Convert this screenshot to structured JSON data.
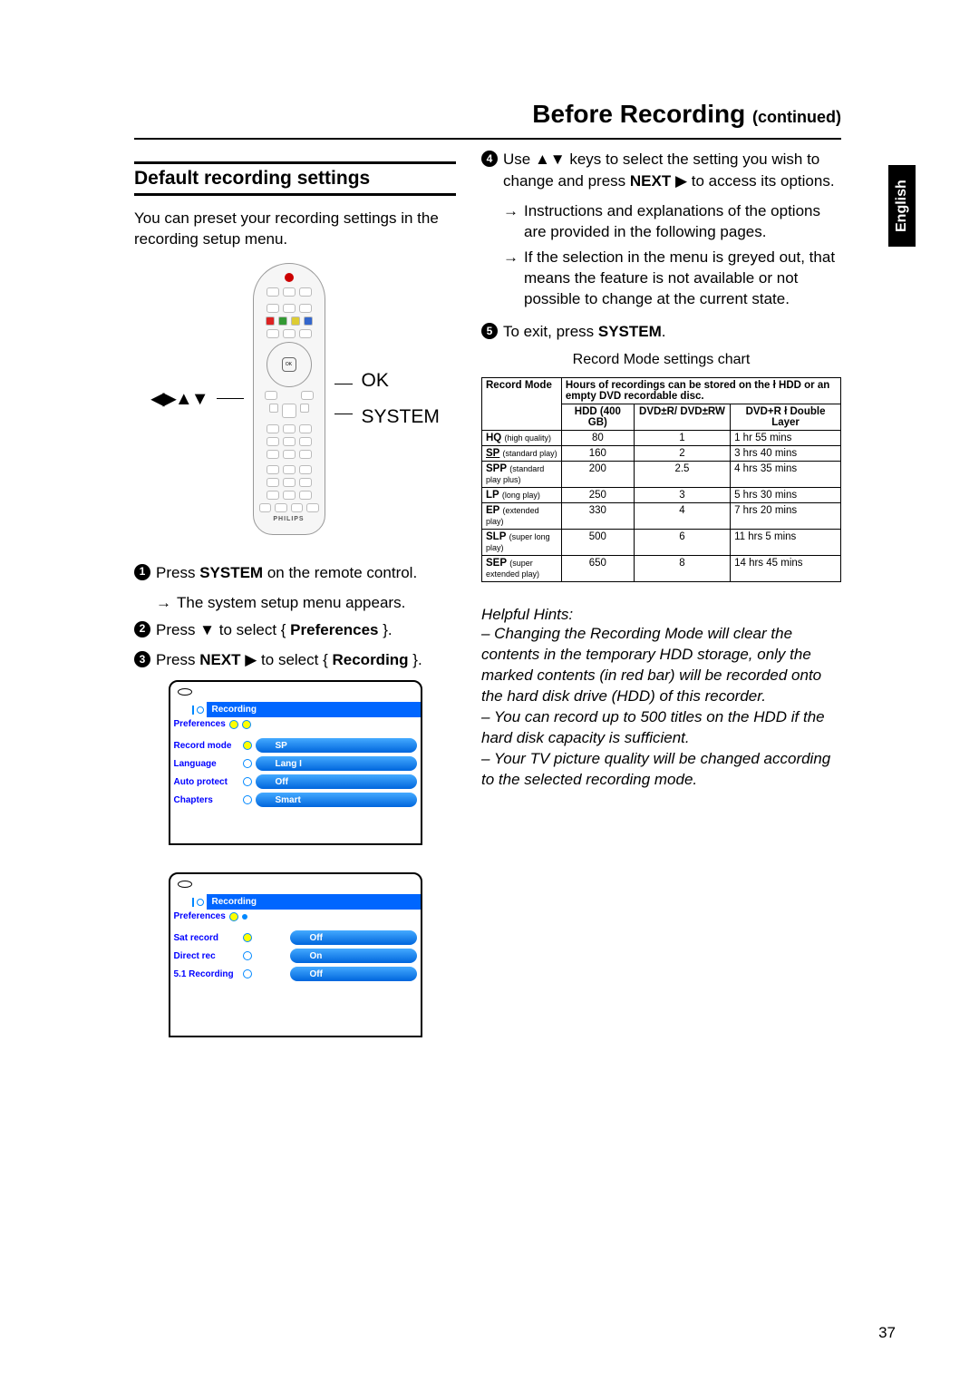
{
  "pageTitle": "Before Recording",
  "pageTitleCont": "(continued)",
  "langTab": "English",
  "pageNumber": "37",
  "section": {
    "heading": "Default recording settings",
    "intro": "You can preset your recording settings in the recording setup menu."
  },
  "remote": {
    "arrows": "◀▶▲▼",
    "okLabel": "OK",
    "systemLabel": "SYSTEM",
    "brand": "PHILIPS"
  },
  "steps": {
    "s1a": "Press ",
    "s1b": "SYSTEM",
    "s1c": " on the remote control.",
    "s1sub": "The system setup menu appears.",
    "s2a": "Press ▼ to select { ",
    "s2b": "Preferences",
    "s2c": " }.",
    "s3a": "Press ",
    "s3b": "NEXT",
    "s3c": " ▶ to select { ",
    "s3d": "Recording",
    "s3e": " }.",
    "s4a": "Use ▲▼ keys to select the setting you wish to change and press ",
    "s4b": "NEXT",
    "s4c": " ▶ to access its options.",
    "s4sub1": "Instructions and explanations of the options are provided in the following pages.",
    "s4sub2": "If the selection in the menu is greyed out, that means the feature is not available or not possible to change at the current state.",
    "s5a": "To exit, press ",
    "s5b": "SYSTEM",
    "s5c": "."
  },
  "screens": {
    "tab": "Recording",
    "pref": "Preferences",
    "menu1": [
      {
        "label": "Record mode",
        "value": "SP"
      },
      {
        "label": "Language",
        "value": "Lang I"
      },
      {
        "label": "Auto protect",
        "value": "Off"
      },
      {
        "label": "Chapters",
        "value": "Smart"
      }
    ],
    "menu2": [
      {
        "label": "Sat record",
        "value": "Off"
      },
      {
        "label": "Direct rec",
        "value": "On"
      },
      {
        "label": "5.1 Recording",
        "value": "Off"
      }
    ]
  },
  "chartCaption": "Record Mode settings chart",
  "chart_data": {
    "type": "table",
    "header_main": "Record Mode",
    "header_desc": "Hours of recordings can be stored on the ł HDD or an empty DVD recordable disc.",
    "columns": [
      "HDD (400 GB)",
      "DVD±R/ DVD±RW",
      "DVD+R ł Double Layer"
    ],
    "rows": [
      {
        "mode": "HQ",
        "sub": "(high quality)",
        "hdd": "80",
        "dvd": "1",
        "dl": "1 hr 55 mins"
      },
      {
        "mode": "SP",
        "sub": "(standard play)",
        "underline": true,
        "hdd": "160",
        "dvd": "2",
        "dl": "3 hrs 40 mins"
      },
      {
        "mode": "SPP",
        "sub": "(standard play plus)",
        "hdd": "200",
        "dvd": "2.5",
        "dl": "4 hrs 35 mins"
      },
      {
        "mode": "LP",
        "sub": "(long play)",
        "hdd": "250",
        "dvd": "3",
        "dl": "5 hrs 30 mins"
      },
      {
        "mode": "EP",
        "sub": "(extended play)",
        "hdd": "330",
        "dvd": "4",
        "dl": "7 hrs 20 mins"
      },
      {
        "mode": "SLP",
        "sub": "(super long play)",
        "hdd": "500",
        "dvd": "6",
        "dl": "11 hrs 5 mins"
      },
      {
        "mode": "SEP",
        "sub": "(super extended play)",
        "hdd": "650",
        "dvd": "8",
        "dl": "14 hrs 45 mins"
      }
    ]
  },
  "hints": {
    "head": "Helpful Hints:",
    "h1": "– Changing the Recording Mode will clear the contents in the temporary HDD storage, only the marked contents (in red bar) will be recorded onto the hard disk drive (HDD) of this recorder.",
    "h2": "– You can record up to 500 titles on the HDD if the hard disk capacity is sufficient.",
    "h3": "– Your TV picture quality will be changed according to the selected recording mode."
  }
}
